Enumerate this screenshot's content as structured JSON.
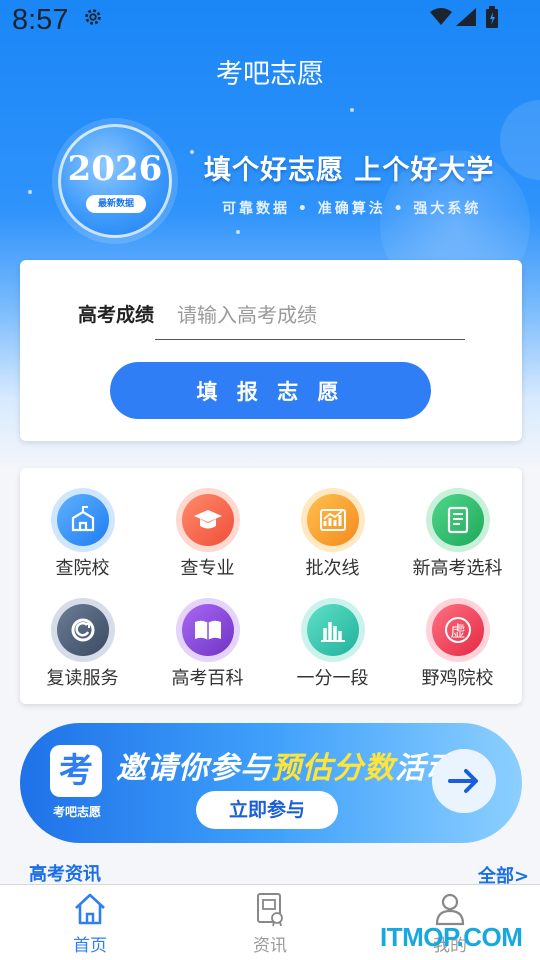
{
  "status_bar": {
    "time": "8:57"
  },
  "header": {
    "title": "考吧志愿"
  },
  "hero": {
    "badge_year": "2026",
    "badge_tag": "最新数据",
    "slogan": "填个好志愿 上个好大学",
    "sub_slogan": "可靠数据 • 准确算法 • 强大系统"
  },
  "score_form": {
    "label": "高考成绩",
    "placeholder": "请输入高考成绩",
    "submit_label": "填 报 志 愿"
  },
  "features": [
    {
      "label": "查院校",
      "icon": "school-icon",
      "color": "#3a93f7"
    },
    {
      "label": "查专业",
      "icon": "graduation-cap-icon",
      "color": "#f2614b"
    },
    {
      "label": "批次线",
      "icon": "bar-chart-icon",
      "color": "#f7a02a"
    },
    {
      "label": "新高考选科",
      "icon": "document-icon",
      "color": "#2fbf72"
    },
    {
      "label": "复读服务",
      "icon": "refresh-icon",
      "color": "#4b5b73"
    },
    {
      "label": "高考百科",
      "icon": "book-icon",
      "color": "#8a4bd8"
    },
    {
      "label": "一分一段",
      "icon": "columns-chart-icon",
      "color": "#35c7b0"
    },
    {
      "label": "野鸡院校",
      "icon": "fake-badge-icon",
      "color": "#f2455b",
      "icon_text": "虚"
    }
  ],
  "banner": {
    "logo_char": "考",
    "logo_name": "考吧志愿",
    "headline_prefix": "邀请你参与",
    "headline_highlight": "预估分数",
    "headline_suffix": "活动",
    "button_label": "立即参与"
  },
  "news": {
    "title": "高考资讯",
    "more_label": "全部>"
  },
  "tabs": [
    {
      "label": "首页",
      "icon": "home-icon",
      "active": true
    },
    {
      "label": "资讯",
      "icon": "news-icon",
      "active": false
    },
    {
      "label": "我的",
      "icon": "user-icon",
      "active": false
    }
  ],
  "watermark": "ITMOP.COM"
}
